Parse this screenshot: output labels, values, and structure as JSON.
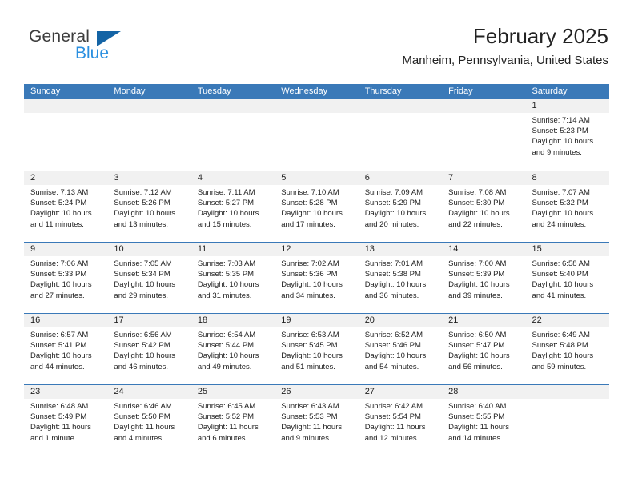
{
  "brand": {
    "name_top": "General",
    "name_bottom": "Blue",
    "accent_color": "#1464a5",
    "blue_text_color": "#2a8fe0"
  },
  "header": {
    "title": "February 2025",
    "subtitle": "Manheim, Pennsylvania, United States"
  },
  "theme": {
    "header_row_bg": "#3a79b8",
    "day_number_bg": "#f1f1f1",
    "grid_line": "#3a79b8",
    "text": "#222222"
  },
  "calendar": {
    "weekday_headers": [
      "Sunday",
      "Monday",
      "Tuesday",
      "Wednesday",
      "Thursday",
      "Friday",
      "Saturday"
    ],
    "labels": {
      "sunrise": "Sunrise:",
      "sunset": "Sunset:",
      "daylight": "Daylight:"
    },
    "weeks": [
      [
        {
          "day": "",
          "empty": true
        },
        {
          "day": "",
          "empty": true
        },
        {
          "day": "",
          "empty": true
        },
        {
          "day": "",
          "empty": true
        },
        {
          "day": "",
          "empty": true
        },
        {
          "day": "",
          "empty": true
        },
        {
          "day": "1",
          "sunrise": "Sunrise: 7:14 AM",
          "sunset": "Sunset: 5:23 PM",
          "daylight": "Daylight: 10 hours and 9 minutes."
        }
      ],
      [
        {
          "day": "2",
          "sunrise": "Sunrise: 7:13 AM",
          "sunset": "Sunset: 5:24 PM",
          "daylight": "Daylight: 10 hours and 11 minutes."
        },
        {
          "day": "3",
          "sunrise": "Sunrise: 7:12 AM",
          "sunset": "Sunset: 5:26 PM",
          "daylight": "Daylight: 10 hours and 13 minutes."
        },
        {
          "day": "4",
          "sunrise": "Sunrise: 7:11 AM",
          "sunset": "Sunset: 5:27 PM",
          "daylight": "Daylight: 10 hours and 15 minutes."
        },
        {
          "day": "5",
          "sunrise": "Sunrise: 7:10 AM",
          "sunset": "Sunset: 5:28 PM",
          "daylight": "Daylight: 10 hours and 17 minutes."
        },
        {
          "day": "6",
          "sunrise": "Sunrise: 7:09 AM",
          "sunset": "Sunset: 5:29 PM",
          "daylight": "Daylight: 10 hours and 20 minutes."
        },
        {
          "day": "7",
          "sunrise": "Sunrise: 7:08 AM",
          "sunset": "Sunset: 5:30 PM",
          "daylight": "Daylight: 10 hours and 22 minutes."
        },
        {
          "day": "8",
          "sunrise": "Sunrise: 7:07 AM",
          "sunset": "Sunset: 5:32 PM",
          "daylight": "Daylight: 10 hours and 24 minutes."
        }
      ],
      [
        {
          "day": "9",
          "sunrise": "Sunrise: 7:06 AM",
          "sunset": "Sunset: 5:33 PM",
          "daylight": "Daylight: 10 hours and 27 minutes."
        },
        {
          "day": "10",
          "sunrise": "Sunrise: 7:05 AM",
          "sunset": "Sunset: 5:34 PM",
          "daylight": "Daylight: 10 hours and 29 minutes."
        },
        {
          "day": "11",
          "sunrise": "Sunrise: 7:03 AM",
          "sunset": "Sunset: 5:35 PM",
          "daylight": "Daylight: 10 hours and 31 minutes."
        },
        {
          "day": "12",
          "sunrise": "Sunrise: 7:02 AM",
          "sunset": "Sunset: 5:36 PM",
          "daylight": "Daylight: 10 hours and 34 minutes."
        },
        {
          "day": "13",
          "sunrise": "Sunrise: 7:01 AM",
          "sunset": "Sunset: 5:38 PM",
          "daylight": "Daylight: 10 hours and 36 minutes."
        },
        {
          "day": "14",
          "sunrise": "Sunrise: 7:00 AM",
          "sunset": "Sunset: 5:39 PM",
          "daylight": "Daylight: 10 hours and 39 minutes."
        },
        {
          "day": "15",
          "sunrise": "Sunrise: 6:58 AM",
          "sunset": "Sunset: 5:40 PM",
          "daylight": "Daylight: 10 hours and 41 minutes."
        }
      ],
      [
        {
          "day": "16",
          "sunrise": "Sunrise: 6:57 AM",
          "sunset": "Sunset: 5:41 PM",
          "daylight": "Daylight: 10 hours and 44 minutes."
        },
        {
          "day": "17",
          "sunrise": "Sunrise: 6:56 AM",
          "sunset": "Sunset: 5:42 PM",
          "daylight": "Daylight: 10 hours and 46 minutes."
        },
        {
          "day": "18",
          "sunrise": "Sunrise: 6:54 AM",
          "sunset": "Sunset: 5:44 PM",
          "daylight": "Daylight: 10 hours and 49 minutes."
        },
        {
          "day": "19",
          "sunrise": "Sunrise: 6:53 AM",
          "sunset": "Sunset: 5:45 PM",
          "daylight": "Daylight: 10 hours and 51 minutes."
        },
        {
          "day": "20",
          "sunrise": "Sunrise: 6:52 AM",
          "sunset": "Sunset: 5:46 PM",
          "daylight": "Daylight: 10 hours and 54 minutes."
        },
        {
          "day": "21",
          "sunrise": "Sunrise: 6:50 AM",
          "sunset": "Sunset: 5:47 PM",
          "daylight": "Daylight: 10 hours and 56 minutes."
        },
        {
          "day": "22",
          "sunrise": "Sunrise: 6:49 AM",
          "sunset": "Sunset: 5:48 PM",
          "daylight": "Daylight: 10 hours and 59 minutes."
        }
      ],
      [
        {
          "day": "23",
          "sunrise": "Sunrise: 6:48 AM",
          "sunset": "Sunset: 5:49 PM",
          "daylight": "Daylight: 11 hours and 1 minute."
        },
        {
          "day": "24",
          "sunrise": "Sunrise: 6:46 AM",
          "sunset": "Sunset: 5:50 PM",
          "daylight": "Daylight: 11 hours and 4 minutes."
        },
        {
          "day": "25",
          "sunrise": "Sunrise: 6:45 AM",
          "sunset": "Sunset: 5:52 PM",
          "daylight": "Daylight: 11 hours and 6 minutes."
        },
        {
          "day": "26",
          "sunrise": "Sunrise: 6:43 AM",
          "sunset": "Sunset: 5:53 PM",
          "daylight": "Daylight: 11 hours and 9 minutes."
        },
        {
          "day": "27",
          "sunrise": "Sunrise: 6:42 AM",
          "sunset": "Sunset: 5:54 PM",
          "daylight": "Daylight: 11 hours and 12 minutes."
        },
        {
          "day": "28",
          "sunrise": "Sunrise: 6:40 AM",
          "sunset": "Sunset: 5:55 PM",
          "daylight": "Daylight: 11 hours and 14 minutes."
        },
        {
          "day": "",
          "empty": true
        }
      ]
    ]
  }
}
